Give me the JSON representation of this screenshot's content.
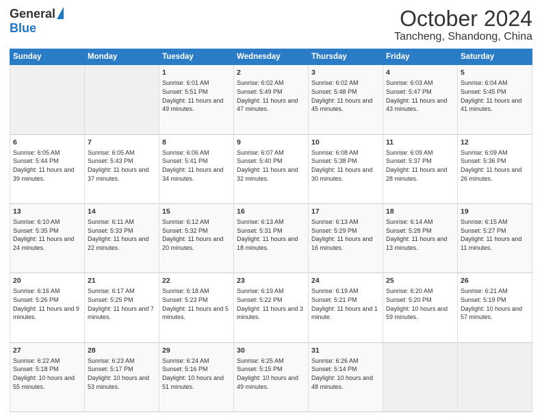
{
  "header": {
    "logo_general": "General",
    "logo_blue": "Blue",
    "month_title": "October 2024",
    "location": "Tancheng, Shandong, China"
  },
  "days_of_week": [
    "Sunday",
    "Monday",
    "Tuesday",
    "Wednesday",
    "Thursday",
    "Friday",
    "Saturday"
  ],
  "weeks": [
    [
      {
        "day": "",
        "info": ""
      },
      {
        "day": "",
        "info": ""
      },
      {
        "day": "1",
        "info": "Sunrise: 6:01 AM\nSunset: 5:51 PM\nDaylight: 11 hours and 49 minutes."
      },
      {
        "day": "2",
        "info": "Sunrise: 6:02 AM\nSunset: 5:49 PM\nDaylight: 11 hours and 47 minutes."
      },
      {
        "day": "3",
        "info": "Sunrise: 6:02 AM\nSunset: 5:48 PM\nDaylight: 11 hours and 45 minutes."
      },
      {
        "day": "4",
        "info": "Sunrise: 6:03 AM\nSunset: 5:47 PM\nDaylight: 11 hours and 43 minutes."
      },
      {
        "day": "5",
        "info": "Sunrise: 6:04 AM\nSunset: 5:45 PM\nDaylight: 11 hours and 41 minutes."
      }
    ],
    [
      {
        "day": "6",
        "info": "Sunrise: 6:05 AM\nSunset: 5:44 PM\nDaylight: 11 hours and 39 minutes."
      },
      {
        "day": "7",
        "info": "Sunrise: 6:05 AM\nSunset: 5:43 PM\nDaylight: 11 hours and 37 minutes."
      },
      {
        "day": "8",
        "info": "Sunrise: 6:06 AM\nSunset: 5:41 PM\nDaylight: 11 hours and 34 minutes."
      },
      {
        "day": "9",
        "info": "Sunrise: 6:07 AM\nSunset: 5:40 PM\nDaylight: 11 hours and 32 minutes."
      },
      {
        "day": "10",
        "info": "Sunrise: 6:08 AM\nSunset: 5:38 PM\nDaylight: 11 hours and 30 minutes."
      },
      {
        "day": "11",
        "info": "Sunrise: 6:09 AM\nSunset: 5:37 PM\nDaylight: 11 hours and 28 minutes."
      },
      {
        "day": "12",
        "info": "Sunrise: 6:09 AM\nSunset: 5:36 PM\nDaylight: 11 hours and 26 minutes."
      }
    ],
    [
      {
        "day": "13",
        "info": "Sunrise: 6:10 AM\nSunset: 5:35 PM\nDaylight: 11 hours and 24 minutes."
      },
      {
        "day": "14",
        "info": "Sunrise: 6:11 AM\nSunset: 5:33 PM\nDaylight: 11 hours and 22 minutes."
      },
      {
        "day": "15",
        "info": "Sunrise: 6:12 AM\nSunset: 5:32 PM\nDaylight: 11 hours and 20 minutes."
      },
      {
        "day": "16",
        "info": "Sunrise: 6:13 AM\nSunset: 5:31 PM\nDaylight: 11 hours and 18 minutes."
      },
      {
        "day": "17",
        "info": "Sunrise: 6:13 AM\nSunset: 5:29 PM\nDaylight: 11 hours and 16 minutes."
      },
      {
        "day": "18",
        "info": "Sunrise: 6:14 AM\nSunset: 5:28 PM\nDaylight: 11 hours and 13 minutes."
      },
      {
        "day": "19",
        "info": "Sunrise: 6:15 AM\nSunset: 5:27 PM\nDaylight: 11 hours and 11 minutes."
      }
    ],
    [
      {
        "day": "20",
        "info": "Sunrise: 6:16 AM\nSunset: 5:26 PM\nDaylight: 11 hours and 9 minutes."
      },
      {
        "day": "21",
        "info": "Sunrise: 6:17 AM\nSunset: 5:25 PM\nDaylight: 11 hours and 7 minutes."
      },
      {
        "day": "22",
        "info": "Sunrise: 6:18 AM\nSunset: 5:23 PM\nDaylight: 11 hours and 5 minutes."
      },
      {
        "day": "23",
        "info": "Sunrise: 6:19 AM\nSunset: 5:22 PM\nDaylight: 11 hours and 3 minutes."
      },
      {
        "day": "24",
        "info": "Sunrise: 6:19 AM\nSunset: 5:21 PM\nDaylight: 11 hours and 1 minute."
      },
      {
        "day": "25",
        "info": "Sunrise: 6:20 AM\nSunset: 5:20 PM\nDaylight: 10 hours and 59 minutes."
      },
      {
        "day": "26",
        "info": "Sunrise: 6:21 AM\nSunset: 5:19 PM\nDaylight: 10 hours and 57 minutes."
      }
    ],
    [
      {
        "day": "27",
        "info": "Sunrise: 6:22 AM\nSunset: 5:18 PM\nDaylight: 10 hours and 55 minutes."
      },
      {
        "day": "28",
        "info": "Sunrise: 6:23 AM\nSunset: 5:17 PM\nDaylight: 10 hours and 53 minutes."
      },
      {
        "day": "29",
        "info": "Sunrise: 6:24 AM\nSunset: 5:16 PM\nDaylight: 10 hours and 51 minutes."
      },
      {
        "day": "30",
        "info": "Sunrise: 6:25 AM\nSunset: 5:15 PM\nDaylight: 10 hours and 49 minutes."
      },
      {
        "day": "31",
        "info": "Sunrise: 6:26 AM\nSunset: 5:14 PM\nDaylight: 10 hours and 48 minutes."
      },
      {
        "day": "",
        "info": ""
      },
      {
        "day": "",
        "info": ""
      }
    ]
  ]
}
